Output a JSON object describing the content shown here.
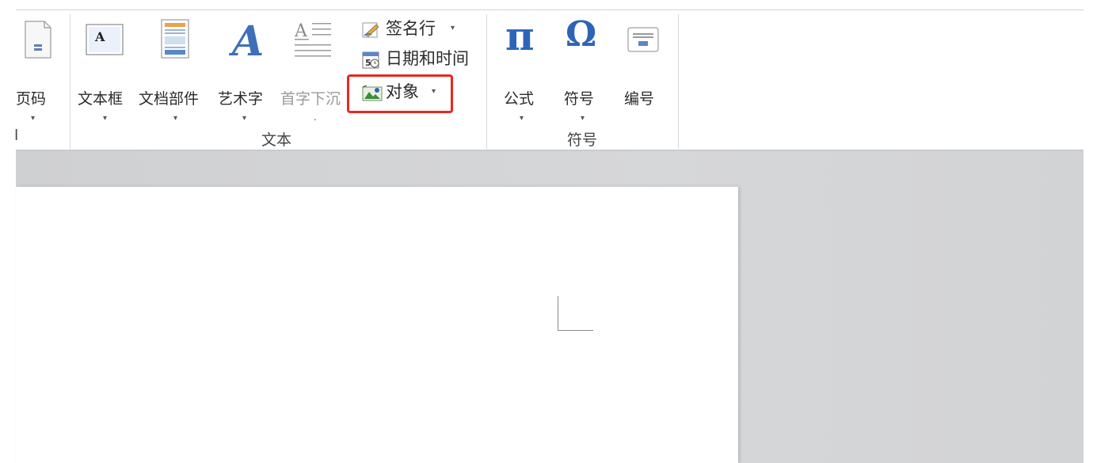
{
  "ribbon": {
    "groups": {
      "page_group_label": "l",
      "text_group_label": "文本",
      "symbols_group_label": "符号"
    },
    "buttons": {
      "page_number": "页码",
      "text_box": "文本框",
      "quick_parts": "文档部件",
      "wordart": "艺术字",
      "drop_cap": "首字下沉",
      "signature_line": "签名行",
      "date_time": "日期和时间",
      "object": "对象",
      "equation": "公式",
      "symbol": "符号",
      "numbering": "编号"
    },
    "dropdown_caret": "▾",
    "icons": {
      "pi": "π",
      "omega": "Ω",
      "wordart_letter": "A",
      "text_box_letter": "A",
      "drop_cap_letter": "A"
    },
    "accent_colors": {
      "highlight": "#e8281f",
      "symbol_blue": "#2e64b8"
    }
  }
}
